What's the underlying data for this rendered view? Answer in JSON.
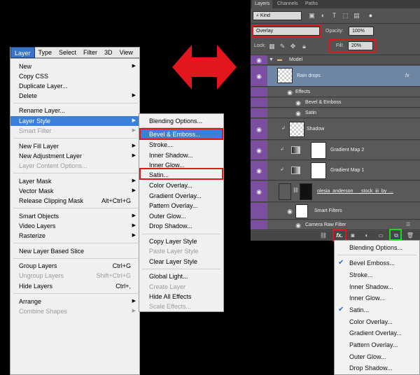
{
  "layer_menu": {
    "menubar": [
      "Layer",
      "Type",
      "Select",
      "Filter",
      "3D",
      "View"
    ],
    "items": [
      {
        "label": "New",
        "shortcut": "",
        "submenu": true,
        "disabled": false
      },
      {
        "label": "Copy CSS",
        "shortcut": "",
        "submenu": false,
        "disabled": false
      },
      {
        "label": "Duplicate Layer...",
        "shortcut": "",
        "submenu": false,
        "disabled": false
      },
      {
        "label": "Delete",
        "shortcut": "",
        "submenu": true,
        "disabled": false
      },
      {
        "label": "Rename Layer...",
        "shortcut": "",
        "submenu": false,
        "disabled": false
      },
      {
        "label": "Layer Style",
        "shortcut": "",
        "submenu": true,
        "disabled": false,
        "highlighted": true
      },
      {
        "label": "Smart Filter",
        "shortcut": "",
        "submenu": true,
        "disabled": true
      },
      {
        "label": "New Fill Layer",
        "shortcut": "",
        "submenu": true,
        "disabled": false
      },
      {
        "label": "New Adjustment Layer",
        "shortcut": "",
        "submenu": true,
        "disabled": false
      },
      {
        "label": "Layer Content Options...",
        "shortcut": "",
        "submenu": false,
        "disabled": true
      },
      {
        "label": "Layer Mask",
        "shortcut": "",
        "submenu": true,
        "disabled": false
      },
      {
        "label": "Vector Mask",
        "shortcut": "",
        "submenu": true,
        "disabled": false
      },
      {
        "label": "Release Clipping Mask",
        "shortcut": "Alt+Ctrl+G",
        "submenu": false,
        "disabled": false
      },
      {
        "label": "Smart Objects",
        "shortcut": "",
        "submenu": true,
        "disabled": false
      },
      {
        "label": "Video Layers",
        "shortcut": "",
        "submenu": true,
        "disabled": false
      },
      {
        "label": "Rasterize",
        "shortcut": "",
        "submenu": true,
        "disabled": false
      },
      {
        "label": "New Layer Based Slice",
        "shortcut": "",
        "submenu": false,
        "disabled": false
      },
      {
        "label": "Group Layers",
        "shortcut": "Ctrl+G",
        "submenu": false,
        "disabled": false
      },
      {
        "label": "Ungroup Layers",
        "shortcut": "Shift+Ctrl+G",
        "submenu": false,
        "disabled": true
      },
      {
        "label": "Hide Layers",
        "shortcut": "Ctrl+,",
        "submenu": false,
        "disabled": false
      },
      {
        "label": "Arrange",
        "shortcut": "",
        "submenu": true,
        "disabled": false
      },
      {
        "label": "Combine Shapes",
        "shortcut": "",
        "submenu": true,
        "disabled": true
      }
    ]
  },
  "layer_style_submenu": {
    "items": [
      {
        "label": "Blending Options...",
        "disabled": false
      },
      {
        "label": "Bevel & Emboss...",
        "disabled": false,
        "highlighted": true
      },
      {
        "label": "Stroke...",
        "disabled": false
      },
      {
        "label": "Inner Shadow...",
        "disabled": false
      },
      {
        "label": "Inner Glow...",
        "disabled": false
      },
      {
        "label": "Satin...",
        "disabled": false
      },
      {
        "label": "Color Overlay...",
        "disabled": false
      },
      {
        "label": "Gradient Overlay...",
        "disabled": false
      },
      {
        "label": "Pattern Overlay...",
        "disabled": false
      },
      {
        "label": "Outer Glow...",
        "disabled": false
      },
      {
        "label": "Drop Shadow...",
        "disabled": false
      },
      {
        "label": "Copy Layer Style",
        "disabled": false
      },
      {
        "label": "Paste Layer Style",
        "disabled": true
      },
      {
        "label": "Clear Layer Style",
        "disabled": false
      },
      {
        "label": "Global Light...",
        "disabled": false
      },
      {
        "label": "Create Layer",
        "disabled": true
      },
      {
        "label": "Hide All Effects",
        "disabled": false
      },
      {
        "label": "Scale Effects...",
        "disabled": true
      }
    ]
  },
  "layers_panel": {
    "tabs": [
      "Layers",
      "Channels",
      "Paths"
    ],
    "filter_kind": "Kind",
    "blend_mode": "Overlay",
    "opacity_label": "Opacity:",
    "opacity_value": "100%",
    "lock_label": "Lock:",
    "fill_label": "Fill:",
    "fill_value": "20%",
    "group_name": "Model",
    "layer_raindrops": "Rain drops",
    "fx_symbol": "fx",
    "effects_label": "Effects",
    "effect_1": "Bevel & Emboss",
    "effect_2": "Satin",
    "layer_shadow": "Shadow",
    "layer_gradient2": "Gradient Map 2",
    "layer_gradient1": "Gradient Map 1",
    "layer_photo": "olesia_anderson___stock_iii_by_...",
    "smart_filters_label": "Smart Filters",
    "camera_raw_label": "Camera Raw Filter",
    "fx_button_label": "fx."
  },
  "fx_menu": {
    "items": [
      {
        "label": "Blending Options...",
        "checked": false
      },
      {
        "label": "Bevel  Emboss...",
        "checked": true
      },
      {
        "label": "Stroke...",
        "checked": false
      },
      {
        "label": "Inner Shadow...",
        "checked": false
      },
      {
        "label": "Inner Glow...",
        "checked": false
      },
      {
        "label": "Satin...",
        "checked": true
      },
      {
        "label": "Color Overlay...",
        "checked": false
      },
      {
        "label": "Gradient Overlay...",
        "checked": false
      },
      {
        "label": "Pattern Overlay...",
        "checked": false
      },
      {
        "label": "Outer Glow...",
        "checked": false
      },
      {
        "label": "Drop Shadow...",
        "checked": false
      }
    ]
  },
  "colors": {
    "highlight_red": "#e3161d",
    "highlight_green": "#1bd81b",
    "menu_selection": "#3a80d8",
    "eye_column": "#7c4ea1"
  }
}
